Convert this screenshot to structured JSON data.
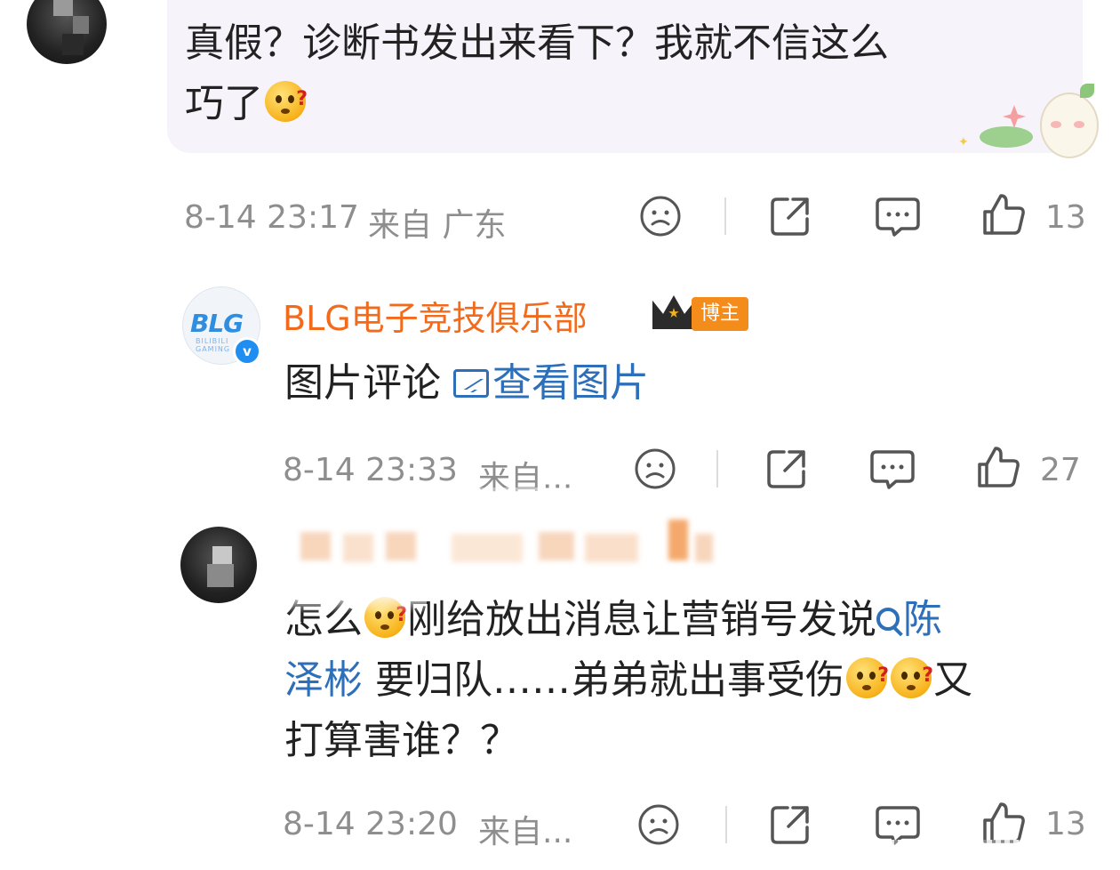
{
  "comment1": {
    "text_line1": "真假？诊断书发出来看下？我就不信这么",
    "text_line2": "巧了",
    "time": "8-14 23:17",
    "location": "来自 广东",
    "like_count": "13"
  },
  "reply_blg": {
    "name": "BLG电子竞技俱乐部",
    "badge": "博主",
    "avatar_logo": "BLG",
    "avatar_sub": "BILIBILI GAMING",
    "body_prefix": "图片评论 ",
    "view_image_label": "查看图片",
    "time": "8-14 23:33",
    "location": "来自...",
    "like_count": "27"
  },
  "comment2": {
    "line1_prefix": "怎么",
    "line1_mid": "刚给放出消息让营销号发说",
    "search_term_part1": "陈",
    "search_term_part2": "泽彬",
    "line2_rest": " 要归队……弟弟就出事受伤",
    "line2_end": "又",
    "line3": "打算害谁？？",
    "time": "8-14 23:20",
    "location": "来自...",
    "like_count": "13"
  },
  "icons": {
    "dislike": "sad-face-icon",
    "share": "share-icon",
    "comment": "comment-icon",
    "like": "thumbs-up-icon"
  },
  "colors": {
    "accent_orange": "#f26b1d",
    "link_blue": "#2d6fb8",
    "meta_gray": "#8e8e8e"
  }
}
